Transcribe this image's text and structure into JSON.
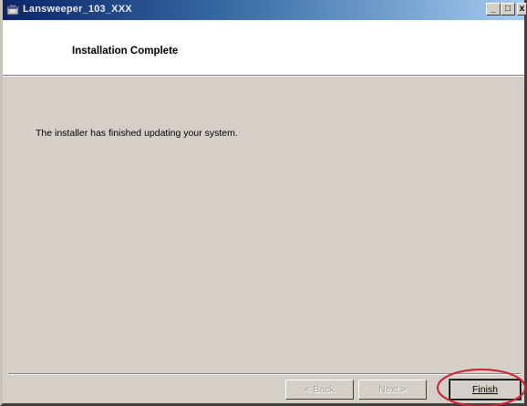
{
  "window": {
    "title": "Lansweeper_103_XXX",
    "controls": {
      "minimize": "_",
      "maximize": "□",
      "close": "x"
    }
  },
  "header": {
    "title": "Installation Complete"
  },
  "content": {
    "message": "The installer has finished updating your system."
  },
  "buttons": {
    "back": "< Back",
    "next": "Next >",
    "finish": "Finish"
  },
  "colors": {
    "titlebar_start": "#0a246a",
    "titlebar_end": "#a6caf0",
    "face": "#d4d0c8",
    "highlight_circle": "#d42030"
  },
  "icons": {
    "app": "installer-icon"
  }
}
